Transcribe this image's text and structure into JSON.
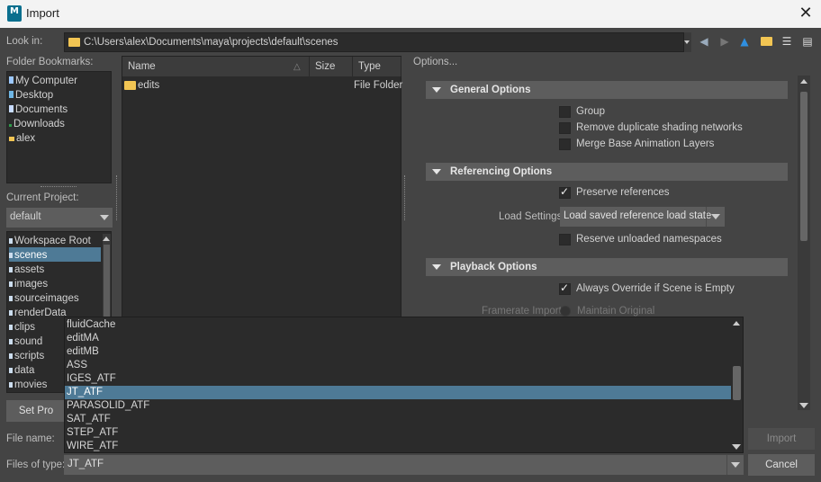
{
  "window": {
    "title": "Import",
    "app_icon_letter": "M"
  },
  "look_in": {
    "label": "Look in:",
    "path": "C:\\Users\\alex\\Documents\\maya\\projects\\default\\scenes"
  },
  "bookmarks": {
    "label": "Folder Bookmarks:",
    "items": [
      "My Computer",
      "Desktop",
      "Documents",
      "Downloads",
      "alex"
    ],
    "icon_colors": [
      "#9cc8ff",
      "#6fb7e6",
      "#c8dcff",
      "#2f9a4a",
      "#f2c553"
    ]
  },
  "project": {
    "label": "Current Project:",
    "value": "default"
  },
  "project_tree": {
    "items": [
      "Workspace Root",
      "scenes",
      "assets",
      "images",
      "sourceimages",
      "renderData",
      "clips",
      "sound",
      "scripts",
      "data",
      "movies"
    ],
    "selected_index": 1
  },
  "set_project_button": "Set Pro",
  "file_list": {
    "columns": [
      "Name",
      "Size",
      "Type"
    ],
    "rows": [
      {
        "name": "edits",
        "size": "",
        "type": "File Folder"
      }
    ]
  },
  "options": {
    "title": "Options...",
    "general": {
      "title": "General Options",
      "group": "Group",
      "remove_dup": "Remove duplicate shading networks",
      "merge_anim": "Merge Base Animation Layers"
    },
    "referencing": {
      "title": "Referencing Options",
      "preserve": "Preserve references",
      "load_settings_label": "Load Settings",
      "load_settings_value": "Load saved reference load state",
      "reserve": "Reserve unloaded namespaces"
    },
    "playback": {
      "title": "Playback Options",
      "always_override": "Always Override if Scene is Empty",
      "framerate_label": "Framerate Import",
      "maintain_original": "Maintain Original"
    }
  },
  "file_name_label": "File name:",
  "files_of_type": {
    "label": "Files of type:",
    "value": "JT_ATF"
  },
  "type_dropdown": {
    "items": [
      "fluidCache",
      "editMA",
      "editMB",
      "ASS",
      "IGES_ATF",
      "JT_ATF",
      "PARASOLID_ATF",
      "SAT_ATF",
      "STEP_ATF",
      "WIRE_ATF"
    ],
    "selected_index": 5
  },
  "buttons": {
    "import": "Import",
    "cancel": "Cancel"
  }
}
